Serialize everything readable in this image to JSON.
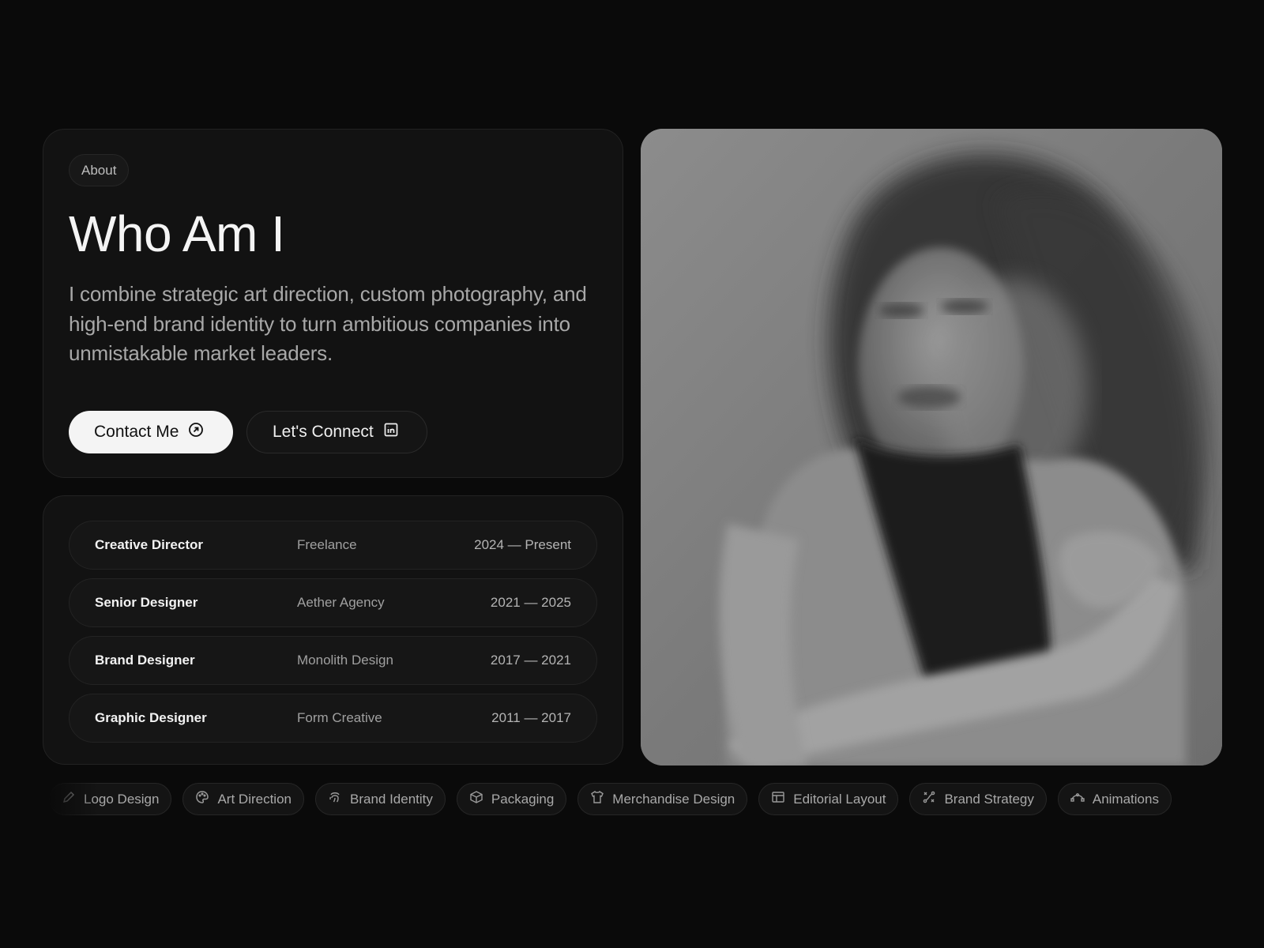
{
  "about": {
    "tag": "About",
    "heading": "Who Am I",
    "intro": "I combine strategic art direction, custom photography, and high-end brand identity to turn ambitious companies into unmistakable market leaders.",
    "contact_label": "Contact Me",
    "connect_label": "Let's Connect"
  },
  "experience": [
    {
      "role": "Creative Director",
      "company": "Freelance",
      "years": "2024 — Present"
    },
    {
      "role": "Senior Designer",
      "company": "Aether Agency",
      "years": "2021 — 2025"
    },
    {
      "role": "Brand Designer",
      "company": "Monolith Design",
      "years": "2017 — 2021"
    },
    {
      "role": "Graphic Designer",
      "company": "Form Creative",
      "years": "2011 — 2017"
    }
  ],
  "skills": [
    {
      "label": "Logo Design",
      "icon": "pen-icon"
    },
    {
      "label": "Art Direction",
      "icon": "palette-icon"
    },
    {
      "label": "Brand Identity",
      "icon": "fingerprint-icon"
    },
    {
      "label": "Packaging",
      "icon": "box-icon"
    },
    {
      "label": "Merchandise Design",
      "icon": "tshirt-icon"
    },
    {
      "label": "Editorial Layout",
      "icon": "layout-icon"
    },
    {
      "label": "Brand Strategy",
      "icon": "strategy-icon"
    },
    {
      "label": "Animations",
      "icon": "bezier-icon"
    }
  ],
  "colors": {
    "background": "#0a0a0a",
    "card": "#121212",
    "primary_button": "#f4f4f4"
  }
}
